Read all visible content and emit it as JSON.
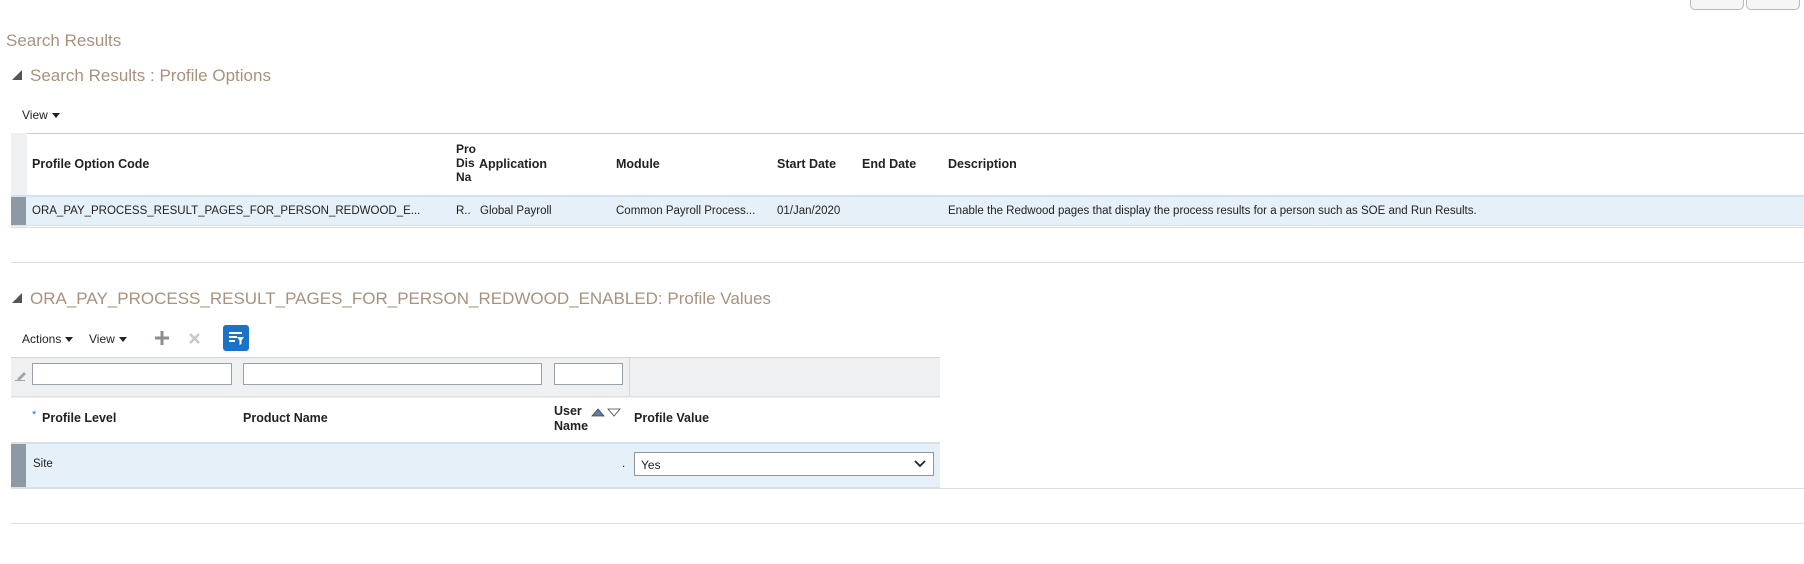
{
  "page": {
    "title": "Search Results"
  },
  "profile_options": {
    "section_title": "Search Results : Profile Options",
    "view_menu_label": "View",
    "columns": {
      "code": "Profile Option Code",
      "display_name_1": "Pro",
      "display_name_2": "Dis",
      "display_name_3": "Na",
      "application": "Application",
      "module": "Module",
      "start_date": "Start Date",
      "end_date": "End Date",
      "description": "Description"
    },
    "row": {
      "code": "ORA_PAY_PROCESS_RESULT_PAGES_FOR_PERSON_REDWOOD_E...",
      "display_name": "R..",
      "application": "Global Payroll",
      "module": "Common Payroll Process...",
      "start_date": "01/Jan/2020",
      "end_date": "",
      "description": "Enable the Redwood pages that display the process results for a person such as SOE and Run Results."
    }
  },
  "profile_values": {
    "section_title": "ORA_PAY_PROCESS_RESULT_PAGES_FOR_PERSON_REDWOOD_ENABLED: Profile Values",
    "actions_menu_label": "Actions",
    "view_menu_label": "View",
    "add_icon": "plus-icon",
    "delete_icon": "x-icon",
    "query_icon": "query-by-example-icon",
    "filters": {
      "profile_level": "",
      "product_name": "",
      "user_name": ""
    },
    "columns": {
      "required_mark": "*",
      "profile_level": "Profile Level",
      "product_name": "Product Name",
      "user_name_1": "User",
      "user_name_2": "Name",
      "profile_value": "Profile Value"
    },
    "row": {
      "profile_level": "Site",
      "product_name": "",
      "user_name": ".",
      "profile_value": "Yes"
    },
    "profile_value_options": [
      "Yes"
    ]
  },
  "colors": {
    "accent": "#a8927e",
    "selected_row": "#e6f0f9",
    "query_button": "#1a73c9"
  }
}
